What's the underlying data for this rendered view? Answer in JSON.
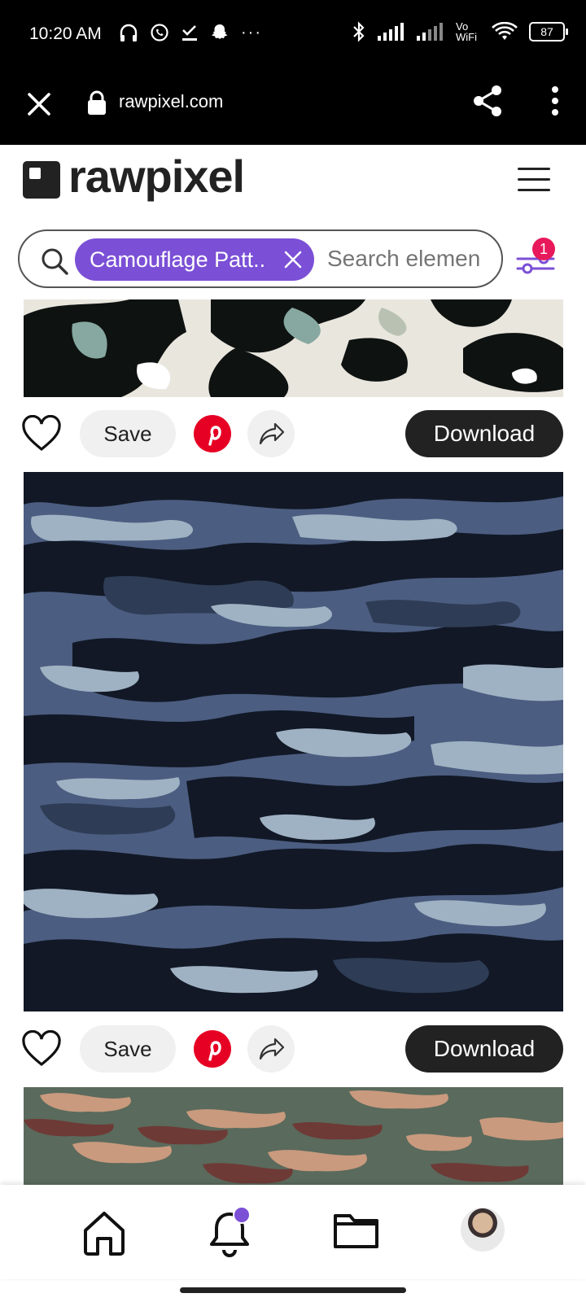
{
  "status_bar": {
    "time": "10:20 AM",
    "left_icons": [
      "headphones-icon",
      "whatsapp-icon",
      "check-download-icon",
      "snapchat-icon"
    ],
    "more": "···",
    "right_icons": [
      "bluetooth-icon",
      "signal-icon",
      "signal-icon",
      "vowifi-icon",
      "wifi-icon"
    ],
    "vowifi": "Vo WiFi",
    "battery": "87"
  },
  "browser": {
    "url": "rawpixel.com"
  },
  "site": {
    "logo_text": "rawpixel"
  },
  "search": {
    "chip_label": "Camouflage Patt..",
    "placeholder": "Search elemen",
    "filter_badge": "1"
  },
  "cards": [
    {
      "save_label": "Save",
      "download_label": "Download"
    },
    {
      "save_label": "Save",
      "download_label": "Download"
    }
  ],
  "bottom_nav": {
    "items": [
      "home-icon",
      "notifications-icon",
      "collections-icon",
      "avatar"
    ],
    "accent": "#7b4fd6"
  },
  "colors": {
    "accent": "#7b4fd6",
    "badge": "#e8195b",
    "pinterest": "#e60023"
  }
}
